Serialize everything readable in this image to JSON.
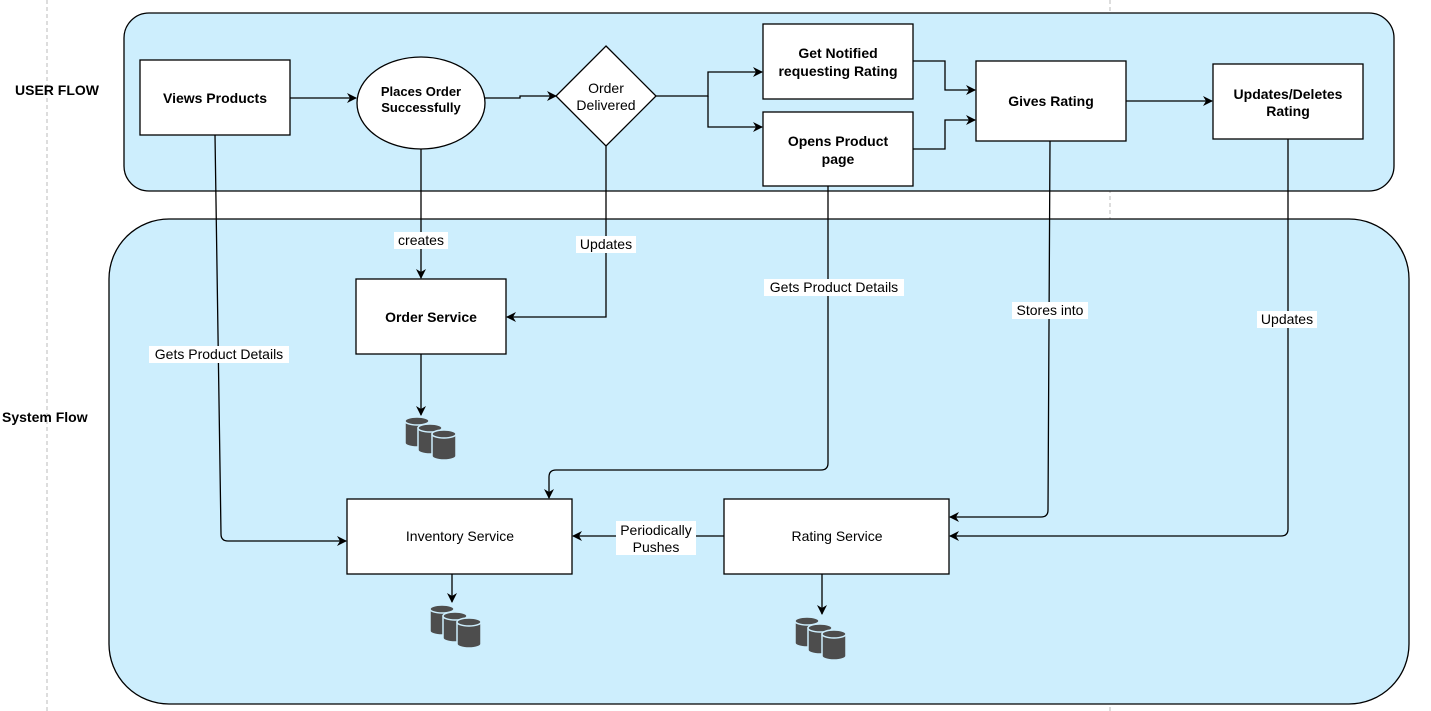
{
  "lanes": {
    "user": "USER FLOW",
    "system": "System Flow"
  },
  "nodes": {
    "views_products": "Views Products",
    "places_order": [
      "Places Order",
      "Successfully"
    ],
    "order_delivered": [
      "Order",
      "Delivered"
    ],
    "get_notified": [
      "Get Notified",
      "requesting Rating"
    ],
    "opens_product": [
      "Opens Product",
      "page"
    ],
    "gives_rating": "Gives Rating",
    "updates_deletes": [
      "Updates/Deletes",
      "Rating"
    ],
    "order_service": "Order Service",
    "inventory_service": "Inventory Service",
    "rating_service": "Rating Service"
  },
  "edge_labels": {
    "creates": "creates",
    "updates_order": "Updates",
    "gets_product_details_1": "Gets Product Details",
    "gets_product_details_2": "Gets Product Details",
    "stores_into": "Stores into",
    "updates_rating": "Updates",
    "periodically_pushes": [
      "Periodically",
      "Pushes"
    ]
  },
  "colors": {
    "lane_fill": "#cdeefd",
    "database": "#4d4d4d"
  },
  "icons": [
    "database-icon"
  ]
}
